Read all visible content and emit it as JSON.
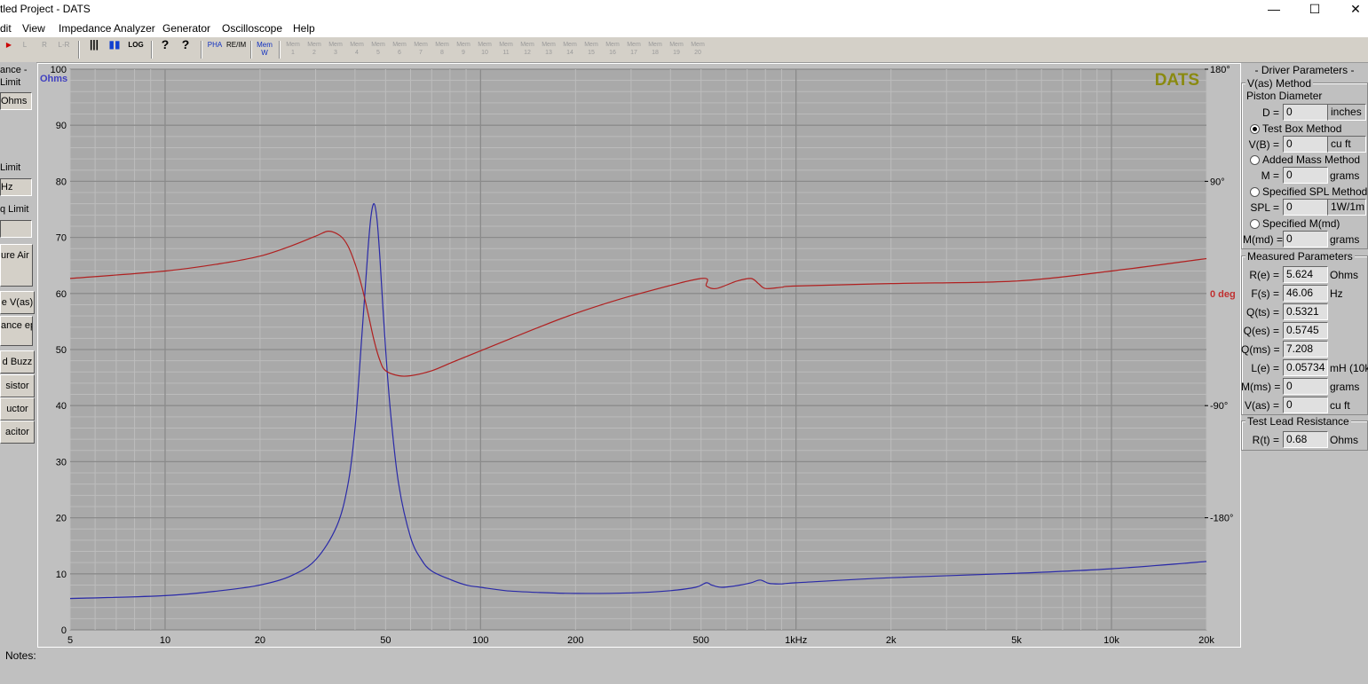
{
  "app": {
    "title": "tled Project - DATS",
    "minimize": "—",
    "maximize": "☐",
    "close": "✕"
  },
  "menu": [
    "dit",
    "View",
    "Impedance Analyzer",
    "Generator",
    "Oscilloscope",
    "Help"
  ],
  "toolbar": {
    "buttons": [
      "L",
      "R",
      "L-R",
      "|||",
      "▮▮",
      "LOG",
      "?",
      "?",
      "PHA",
      "RE/IM",
      "Mem W"
    ],
    "mem_slots": [
      "Mem 1",
      "Mem 2",
      "Mem 3",
      "Mem 4",
      "Mem 5",
      "Mem 6",
      "Mem 7",
      "Mem 8",
      "Mem 9",
      "Mem 10",
      "Mem 11",
      "Mem 12",
      "Mem 13",
      "Mem 14",
      "Mem 15",
      "Mem 16",
      "Mem 17",
      "Mem 18",
      "Mem 19",
      "Mem 20"
    ]
  },
  "left_panel": {
    "impedance_title": "ance -",
    "upper_limit_label": "Limit",
    "upper_limit_value": "Ohms",
    "lower_limit_label": "Limit",
    "lower_limit_value": "Hz",
    "freq_limit_label": "q Limit",
    "freq_limit_value": "",
    "buttons": [
      "ure Air eters",
      "e V(as)",
      "ance ep",
      "d Buzz",
      "sistor",
      "uctor",
      "acitor"
    ]
  },
  "notes_label": "Notes:",
  "right_panel": {
    "title": "- Driver Parameters -",
    "vas_group": "V(as) Method",
    "piston_label": "Piston Diameter",
    "d_label": "D =",
    "d_value": "0",
    "d_unit": "inches",
    "test_box_label": "Test Box Method",
    "vb_label": "V(B) =",
    "vb_value": "0",
    "vb_unit": "cu ft",
    "added_mass_label": "Added Mass Method",
    "m_label": "M =",
    "m_value": "0",
    "m_unit": "grams",
    "spl_method_label": "Specified SPL Method",
    "spl_label": "SPL =",
    "spl_value": "0",
    "spl_unit": "1W/1m",
    "mmd_method_label": "Specified M(md)",
    "mmd_label": "M(md) =",
    "mmd_value": "0",
    "mmd_unit": "grams",
    "measured_group": "Measured Parameters",
    "measured": [
      {
        "label": "R(e) =",
        "value": "5.624",
        "unit": "Ohms"
      },
      {
        "label": "F(s) =",
        "value": "46.06",
        "unit": "Hz"
      },
      {
        "label": "Q(ts) =",
        "value": "0.5321",
        "unit": ""
      },
      {
        "label": "Q(es) =",
        "value": "0.5745",
        "unit": ""
      },
      {
        "label": "Q(ms) =",
        "value": "7.208",
        "unit": ""
      },
      {
        "label": "L(e) =",
        "value": "0.05734",
        "unit": "mH (10k)"
      },
      {
        "label": "M(ms) =",
        "value": "0",
        "unit": "grams"
      },
      {
        "label": "V(as) =",
        "value": "0",
        "unit": "cu ft"
      }
    ],
    "lead_group": "Test Lead Resistance",
    "rt_label": "R(t) =",
    "rt_value": "0.68",
    "rt_unit": "Ohms"
  },
  "chart_data": {
    "type": "line",
    "brand": "DATS",
    "x_scale": "log",
    "xlim": [
      5,
      20000
    ],
    "x_ticks": [
      5,
      10,
      20,
      50,
      100,
      200,
      500,
      1000,
      2000,
      5000,
      10000,
      20000
    ],
    "x_tick_labels": [
      "5",
      "10",
      "20",
      "50",
      "100",
      "200",
      "500",
      "1kHz",
      "2k",
      "5k",
      "10k",
      "20k"
    ],
    "y_left_unit": "Ohms",
    "ylim_left": [
      0,
      100
    ],
    "y_left_ticks": [
      "0",
      "10",
      "20",
      "30",
      "40",
      "50",
      "60",
      "70",
      "80",
      "90",
      "100"
    ],
    "y_right_unit": "0 deg",
    "ylim_right": [
      -270,
      180
    ],
    "y_right_ticks": [
      {
        "value": 180,
        "label": "180°"
      },
      {
        "value": 90,
        "label": "90°"
      },
      {
        "value": 0,
        "label": "0 deg"
      },
      {
        "value": -90,
        "label": "-90°"
      },
      {
        "value": -180,
        "label": "-180°"
      }
    ],
    "grid": true,
    "colors": {
      "impedance": "#2a2aa8",
      "phase": "#b02020",
      "ohms_label": "#4040c0",
      "deg_label": "#c03030",
      "brand": "#8a8a10",
      "plot_bg": "#a9a9a9"
    },
    "series": [
      {
        "key": "impedance",
        "axis": "left",
        "x": [
          5,
          10,
          15,
          20,
          25,
          30,
          35,
          38,
          40,
          42,
          44,
          45,
          46,
          47,
          48,
          50,
          52,
          55,
          60,
          65,
          70,
          80,
          90,
          100,
          120,
          150,
          200,
          300,
          400,
          480,
          520,
          540,
          580,
          650,
          720,
          770,
          820,
          900,
          1000,
          2000,
          5000,
          10000,
          20000
        ],
        "y": [
          5.6,
          6.1,
          7.0,
          8.0,
          9.6,
          12.5,
          18.5,
          26,
          36,
          52,
          68,
          74,
          76,
          73,
          66,
          50,
          38,
          26,
          16.5,
          12.5,
          10.5,
          9.0,
          8.0,
          7.6,
          7.0,
          6.7,
          6.5,
          6.6,
          7.0,
          7.6,
          8.4,
          8.0,
          7.6,
          7.9,
          8.4,
          8.9,
          8.3,
          8.2,
          8.4,
          9.3,
          10.1,
          10.9,
          12.2
        ]
      },
      {
        "key": "phase",
        "axis": "right",
        "x": [
          5,
          10,
          15,
          20,
          25,
          30,
          33,
          36,
          38,
          40,
          42,
          44,
          46,
          48,
          50,
          55,
          60,
          70,
          80,
          100,
          150,
          200,
          300,
          500,
          520,
          560,
          650,
          720,
          760,
          800,
          900,
          1000,
          2000,
          5000,
          10000,
          20000
        ],
        "y": [
          12,
          18,
          24,
          30,
          38,
          46,
          50,
          46,
          38,
          24,
          6,
          -16,
          -38,
          -54,
          -62,
          -66,
          -66,
          -62,
          -56,
          -46,
          -28,
          -16,
          -2,
          12,
          6,
          4,
          10,
          12,
          8,
          4,
          5,
          6,
          8,
          10,
          18,
          28
        ]
      }
    ]
  }
}
